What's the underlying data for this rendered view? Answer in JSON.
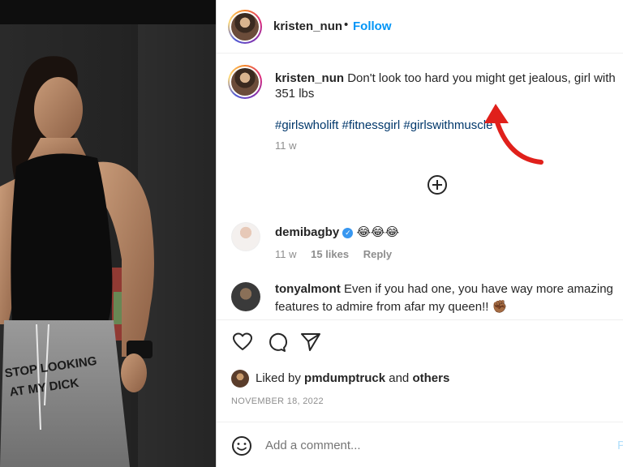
{
  "post": {
    "username": "kristen_nun",
    "separator": "•",
    "follow_label": "Follow"
  },
  "caption": {
    "username": "kristen_nun",
    "text": "Don't look too hard you might get jealous, girl with",
    "text_line2": "351 lbs",
    "hashtags": "#girlswholift #fitnessgirl #girlswithmuscle",
    "time": "11 w"
  },
  "comments": [
    {
      "username": "demibagby",
      "verified": true,
      "text": "😂😂😂",
      "time": "11 w",
      "likes": "15 likes",
      "reply": "Reply"
    },
    {
      "username": "tonyalmont",
      "text_line1": "Even if you had one, you have way more amazing",
      "text_line2": "features to admire from afar my queen!! ✊🏾"
    }
  ],
  "liked_by": {
    "prefix": "Liked by",
    "user": "pmdumptruck",
    "and": "and",
    "others": "others"
  },
  "date": "NOVEMBER 18, 2022",
  "add_comment": {
    "placeholder": "Add a comment...",
    "post_label": "P"
  },
  "photo": {
    "shirt_text_line1": "STOP LOOKING",
    "shirt_text_line2": "AT MY DICK"
  },
  "icons": {
    "like": "heart-icon",
    "comment": "speech-bubble-icon",
    "share": "paper-plane-icon",
    "more": "plus-circle-icon",
    "emoji": "smiley-icon"
  },
  "colors": {
    "accent": "#0095f6",
    "hashtag": "#00376b",
    "annotation_arrow": "#e0201b"
  }
}
